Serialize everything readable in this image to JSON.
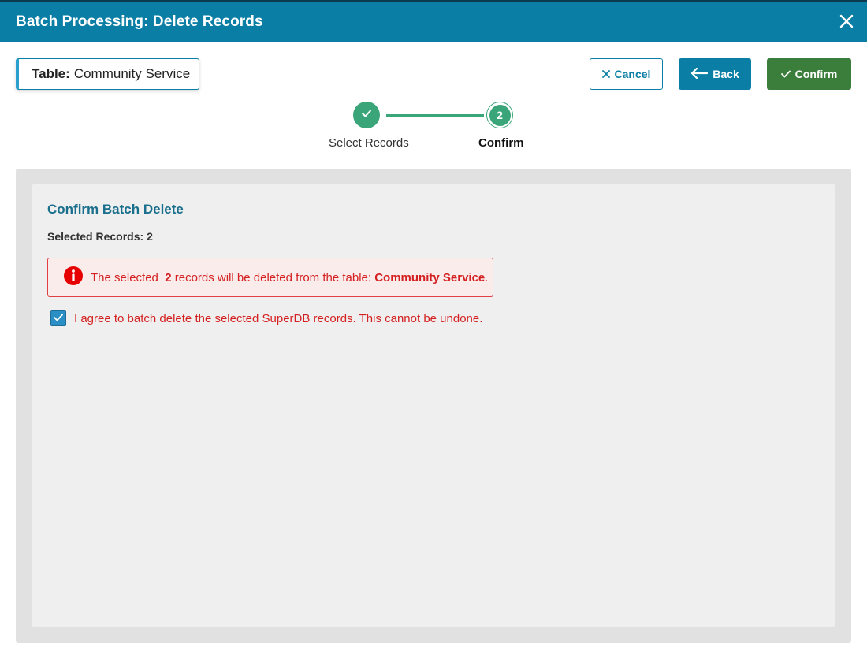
{
  "header": {
    "title": "Batch Processing: Delete Records"
  },
  "table_chip": {
    "label": "Table:",
    "value": "Community Service"
  },
  "toolbar": {
    "cancel_label": "Cancel",
    "back_label": "Back",
    "confirm_label": "Confirm"
  },
  "stepper": {
    "steps": [
      {
        "label": "Select Records",
        "status": "complete"
      },
      {
        "label": "Confirm",
        "number": "2",
        "status": "active"
      }
    ]
  },
  "main": {
    "section_title": "Confirm Batch Delete",
    "selected_label": "Selected Records:",
    "selected_count": "2",
    "alert": {
      "prefix": "The selected",
      "count": "2",
      "middle": "records will be deleted from the table:",
      "table": "Community Service",
      "suffix": "."
    },
    "agree_text": "I agree to batch delete the selected SuperDB records. This cannot be undone.",
    "agree_checked": true
  },
  "colors": {
    "header_bg": "#0a7ea4",
    "confirm_bg": "#3b7d3b",
    "step_green": "#3aa578",
    "alert_red": "#d42020"
  }
}
